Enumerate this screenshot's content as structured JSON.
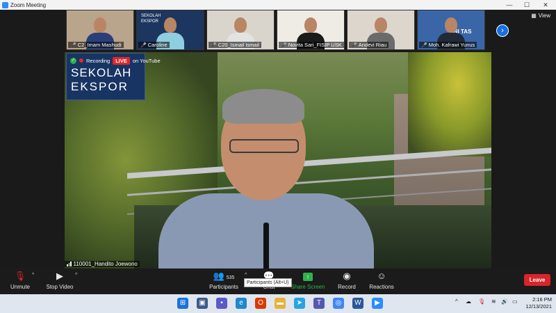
{
  "window": {
    "title": "Zoom Meeting",
    "controls": [
      "—",
      "☐",
      "✕"
    ]
  },
  "view_label": "View",
  "participants_strip": [
    {
      "name": "C2_Imam Mashudi",
      "bg": "#b9a48c",
      "shirt": "#2a3f7a"
    },
    {
      "name": "Caroline",
      "bg": "#1d3660",
      "shirt": "#8fcde0"
    },
    {
      "name": "C20_Ismail Ismail",
      "bg": "#d9d4cc",
      "shirt": "#e3e3e3"
    },
    {
      "name": "Novita Sari_FISIP USK",
      "bg": "#efece6",
      "shirt": "#1b1b1b"
    },
    {
      "name": "Andevi Riau",
      "bg": "#dcd6cc",
      "shirt": "#6b6b6b"
    },
    {
      "name": "Moh. Kafrawi Yunus",
      "bg": "#3a66a8",
      "shirt": "#222a3a"
    }
  ],
  "strip_bg_text": {
    "caroline": "SEKOLAH EKSPOR",
    "kafrawi": "UNI TAS"
  },
  "logo": {
    "line1": "SEKOLAH",
    "line2": "EKSPOR"
  },
  "recording": {
    "label": "Recording",
    "live": "LIVE",
    "platform": "on YouTube"
  },
  "active_speaker": "110001_Handito Joewono",
  "toolbar": {
    "unmute": "Unmute",
    "stop_video": "Stop Video",
    "participants": "Participants",
    "participants_count": "535",
    "chat": "Chat",
    "share_screen": "Share Screen",
    "record": "Record",
    "reactions": "Reactions",
    "leave": "Leave",
    "tooltip": "Participants (Alt+U)"
  },
  "clock": {
    "time": "2:16 PM",
    "date": "12/13/2021"
  },
  "colors": {
    "accent": "#2d8cff",
    "leave": "#d9252a",
    "share": "#2db34a",
    "live": "#e02828"
  }
}
